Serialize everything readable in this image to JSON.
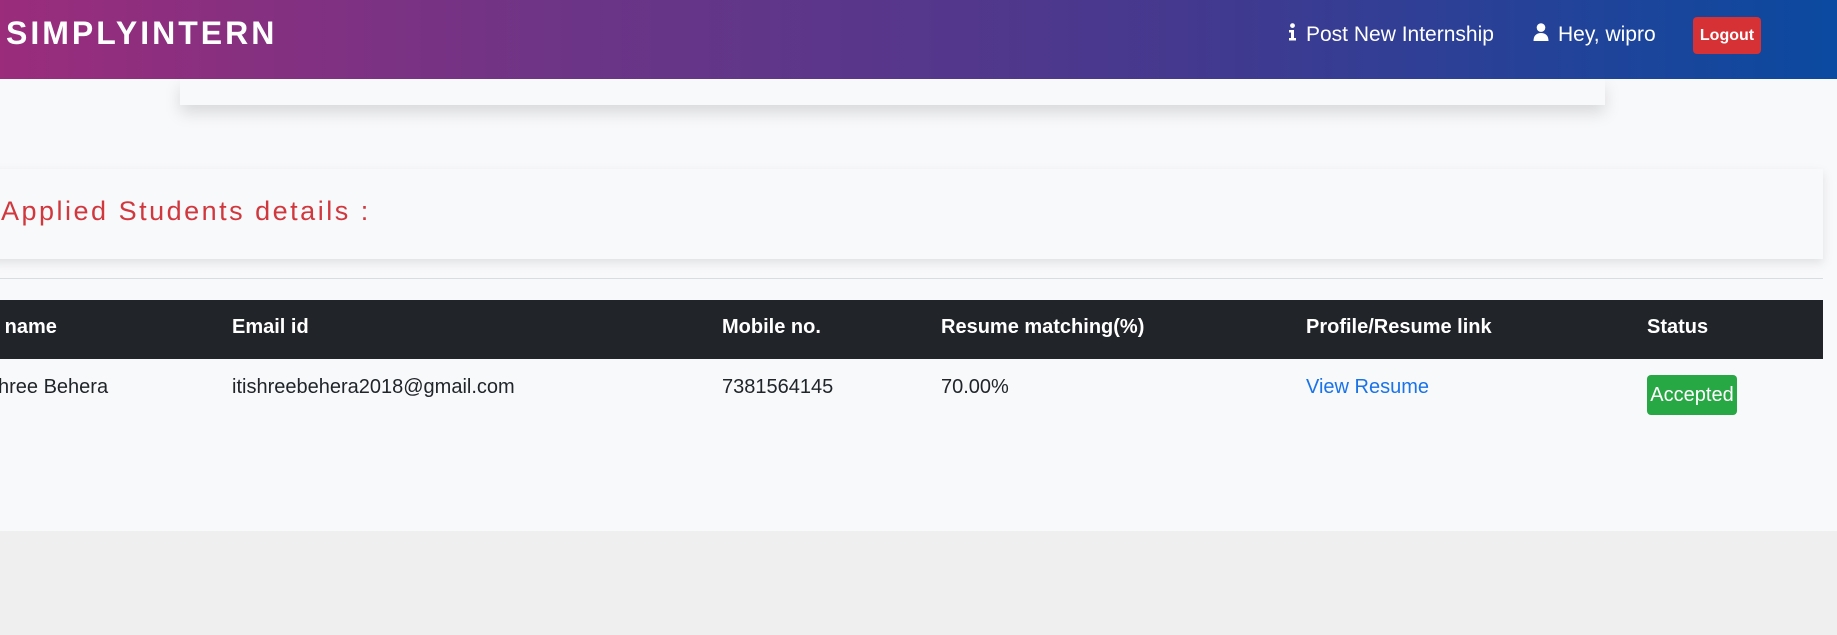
{
  "navbar": {
    "brand": "SIMPLYINTERN",
    "post_link": "Post New Internship",
    "greeting": "Hey, wipro",
    "logout_label": "Logout",
    "post_icon": "info-icon",
    "user_icon": "user-icon"
  },
  "section": {
    "heading": "Applied Students details :"
  },
  "table": {
    "headers": [
      "ll name",
      "Email id",
      "Mobile no.",
      "Resume matching(%)",
      "Profile/Resume link",
      "Status"
    ],
    "rows": [
      {
        "name": "shree Behera",
        "email": "itishreebehera2018@gmail.com",
        "mobile": "7381564145",
        "match": "70.00%",
        "link": "View Resume",
        "status": "Accepted"
      }
    ]
  },
  "colors": {
    "accent": "#d0383e",
    "header_dark": "#212429",
    "status_green": "#28a745",
    "logout_red": "#d63135",
    "link_blue": "#1a73e8"
  }
}
